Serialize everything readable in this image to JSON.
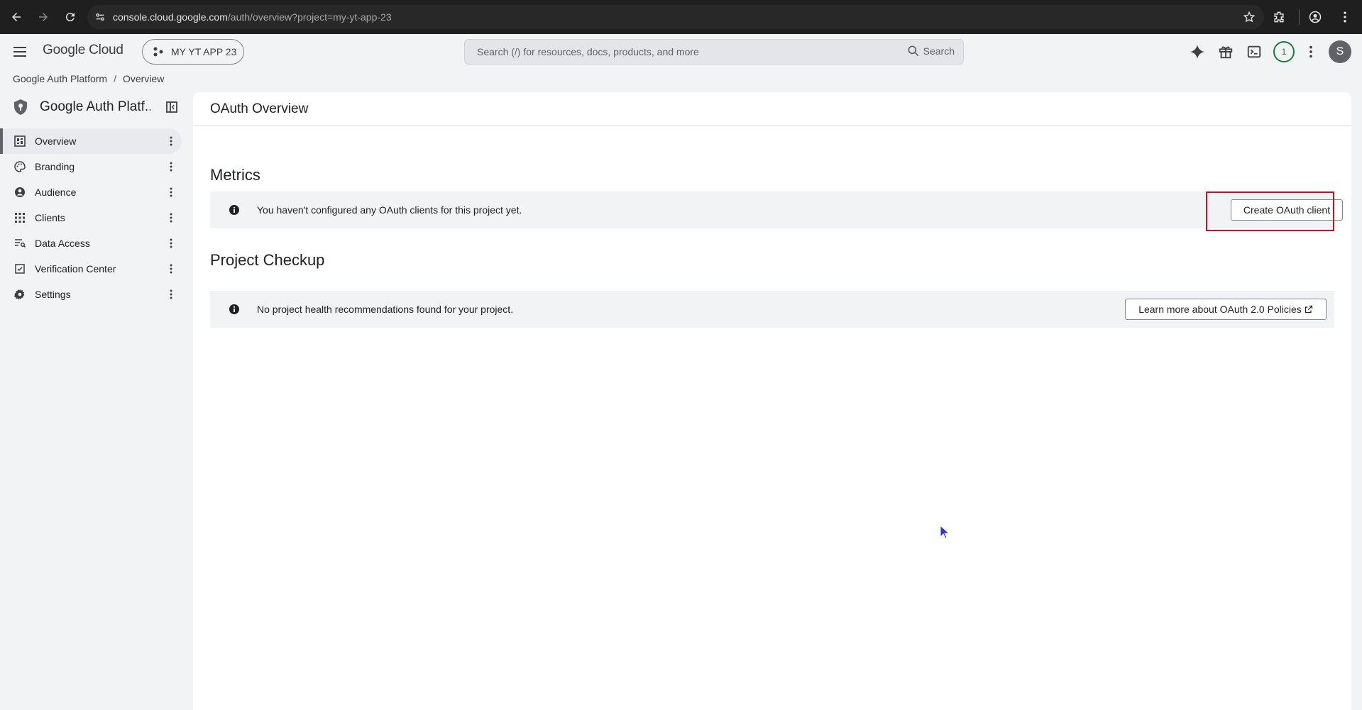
{
  "browser": {
    "url_host": "console.cloud.google.com",
    "url_path": "/auth/overview?project=my-yt-app-23"
  },
  "topbar": {
    "logo": "Google Cloud",
    "project": "MY YT APP 23",
    "search_placeholder": "Search (/) for resources, docs, products, and more",
    "search_label": "Search",
    "notifications_count": "1",
    "avatar_initial": "S"
  },
  "breadcrumb": {
    "root": "Google Auth Platform",
    "separator": "/",
    "current": "Overview"
  },
  "sidebar": {
    "title": "Google Auth Platf...",
    "items": [
      {
        "label": "Overview",
        "icon": "dashboard-icon",
        "active": true
      },
      {
        "label": "Branding",
        "icon": "palette-icon",
        "active": false
      },
      {
        "label": "Audience",
        "icon": "account-circle-icon",
        "active": false
      },
      {
        "label": "Clients",
        "icon": "apps-grid-icon",
        "active": false
      },
      {
        "label": "Data Access",
        "icon": "filter-list-icon",
        "active": false
      },
      {
        "label": "Verification Center",
        "icon": "checkbox-icon",
        "active": false
      },
      {
        "label": "Settings",
        "icon": "gear-icon",
        "active": false
      }
    ]
  },
  "main": {
    "title": "OAuth Overview",
    "metrics": {
      "heading": "Metrics",
      "message": "You haven't configured any OAuth clients for this project yet.",
      "button": "Create OAuth client"
    },
    "checkup": {
      "heading": "Project Checkup",
      "message": "No project health recommendations found for your project.",
      "button": "Learn more about OAuth 2.0 Policies"
    }
  },
  "colors": {
    "highlight": "#d20f19",
    "notification": "#188038",
    "active_nav": "#e8eaed"
  }
}
